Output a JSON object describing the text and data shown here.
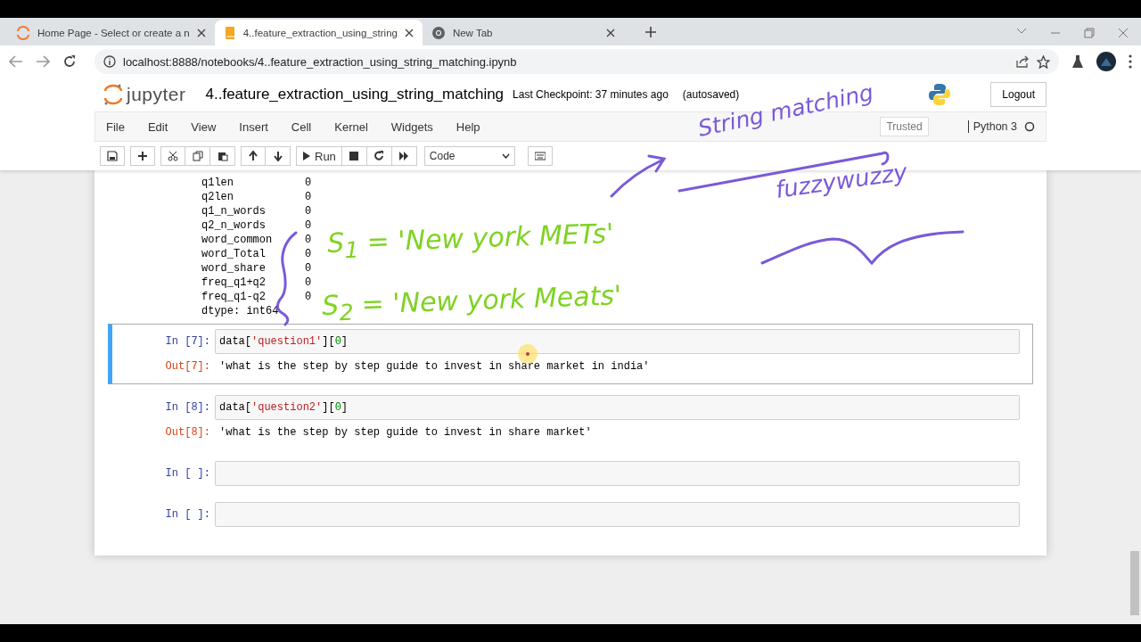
{
  "browser": {
    "tabs": [
      {
        "title": "Home Page - Select or create a n",
        "kind": "jupyter",
        "selected": false
      },
      {
        "title": "4..feature_extraction_using_string",
        "kind": "notebook",
        "selected": true
      },
      {
        "title": "New Tab",
        "kind": "chrome",
        "selected": false
      }
    ],
    "url": "localhost:8888/notebooks/4..feature_extraction_using_string_matching.ipynb"
  },
  "header": {
    "logo_text": "jupyter",
    "notebook_name": "4..feature_extraction_using_string_matching",
    "checkpoint": "Last Checkpoint: 37 minutes ago",
    "autosave": "(autosaved)",
    "logout": "Logout"
  },
  "menu": {
    "items": [
      "File",
      "Edit",
      "View",
      "Insert",
      "Cell",
      "Kernel",
      "Widgets",
      "Help"
    ],
    "trusted": "Trusted",
    "kernel": "Python 3"
  },
  "toolbar": {
    "run": "Run",
    "cell_type": "Code"
  },
  "output_listing": {
    "rows": [
      {
        "name": "q1len",
        "value": "0"
      },
      {
        "name": "q2len",
        "value": "0"
      },
      {
        "name": "q1_n_words",
        "value": "0"
      },
      {
        "name": "q2_n_words",
        "value": "0"
      },
      {
        "name": "word_common",
        "value": "0"
      },
      {
        "name": "word_Total",
        "value": "0"
      },
      {
        "name": "word_share",
        "value": "0"
      },
      {
        "name": "freq_q1+q2",
        "value": "0"
      },
      {
        "name": "freq_q1-q2",
        "value": "0"
      }
    ],
    "dtype": "dtype: int64"
  },
  "cells": [
    {
      "prompt_in": "In [7]:",
      "selected": true,
      "code": [
        {
          "kind": "plain",
          "text": "data["
        },
        {
          "kind": "string",
          "text": "'question1'"
        },
        {
          "kind": "plain",
          "text": "]["
        },
        {
          "kind": "number",
          "text": "0"
        },
        {
          "kind": "plain",
          "text": "]"
        }
      ],
      "prompt_out": "Out[7]:",
      "output": "'what is the step by step guide to invest in share market in india'"
    },
    {
      "prompt_in": "In [8]:",
      "selected": false,
      "code": [
        {
          "kind": "plain",
          "text": "data["
        },
        {
          "kind": "string",
          "text": "'question2'"
        },
        {
          "kind": "plain",
          "text": "]["
        },
        {
          "kind": "number",
          "text": "0"
        },
        {
          "kind": "plain",
          "text": "]"
        }
      ],
      "prompt_out": "Out[8]:",
      "output": "'what is the step by step guide to invest in share market'"
    },
    {
      "prompt_in": "In [ ]:",
      "selected": false
    },
    {
      "prompt_in": "In [ ]:",
      "selected": false
    }
  ],
  "annotations": [
    {
      "text": "String matching",
      "color": "#7a5ad8"
    },
    {
      "text": "fuzzywuzzy",
      "color": "#7a5ad8"
    },
    {
      "text": "S$_{1}$ = 'New york METs'",
      "color": "#7ed321"
    },
    {
      "text": "S$_{2}$ = 'New york Meats'",
      "color": "#7ed321"
    }
  ]
}
